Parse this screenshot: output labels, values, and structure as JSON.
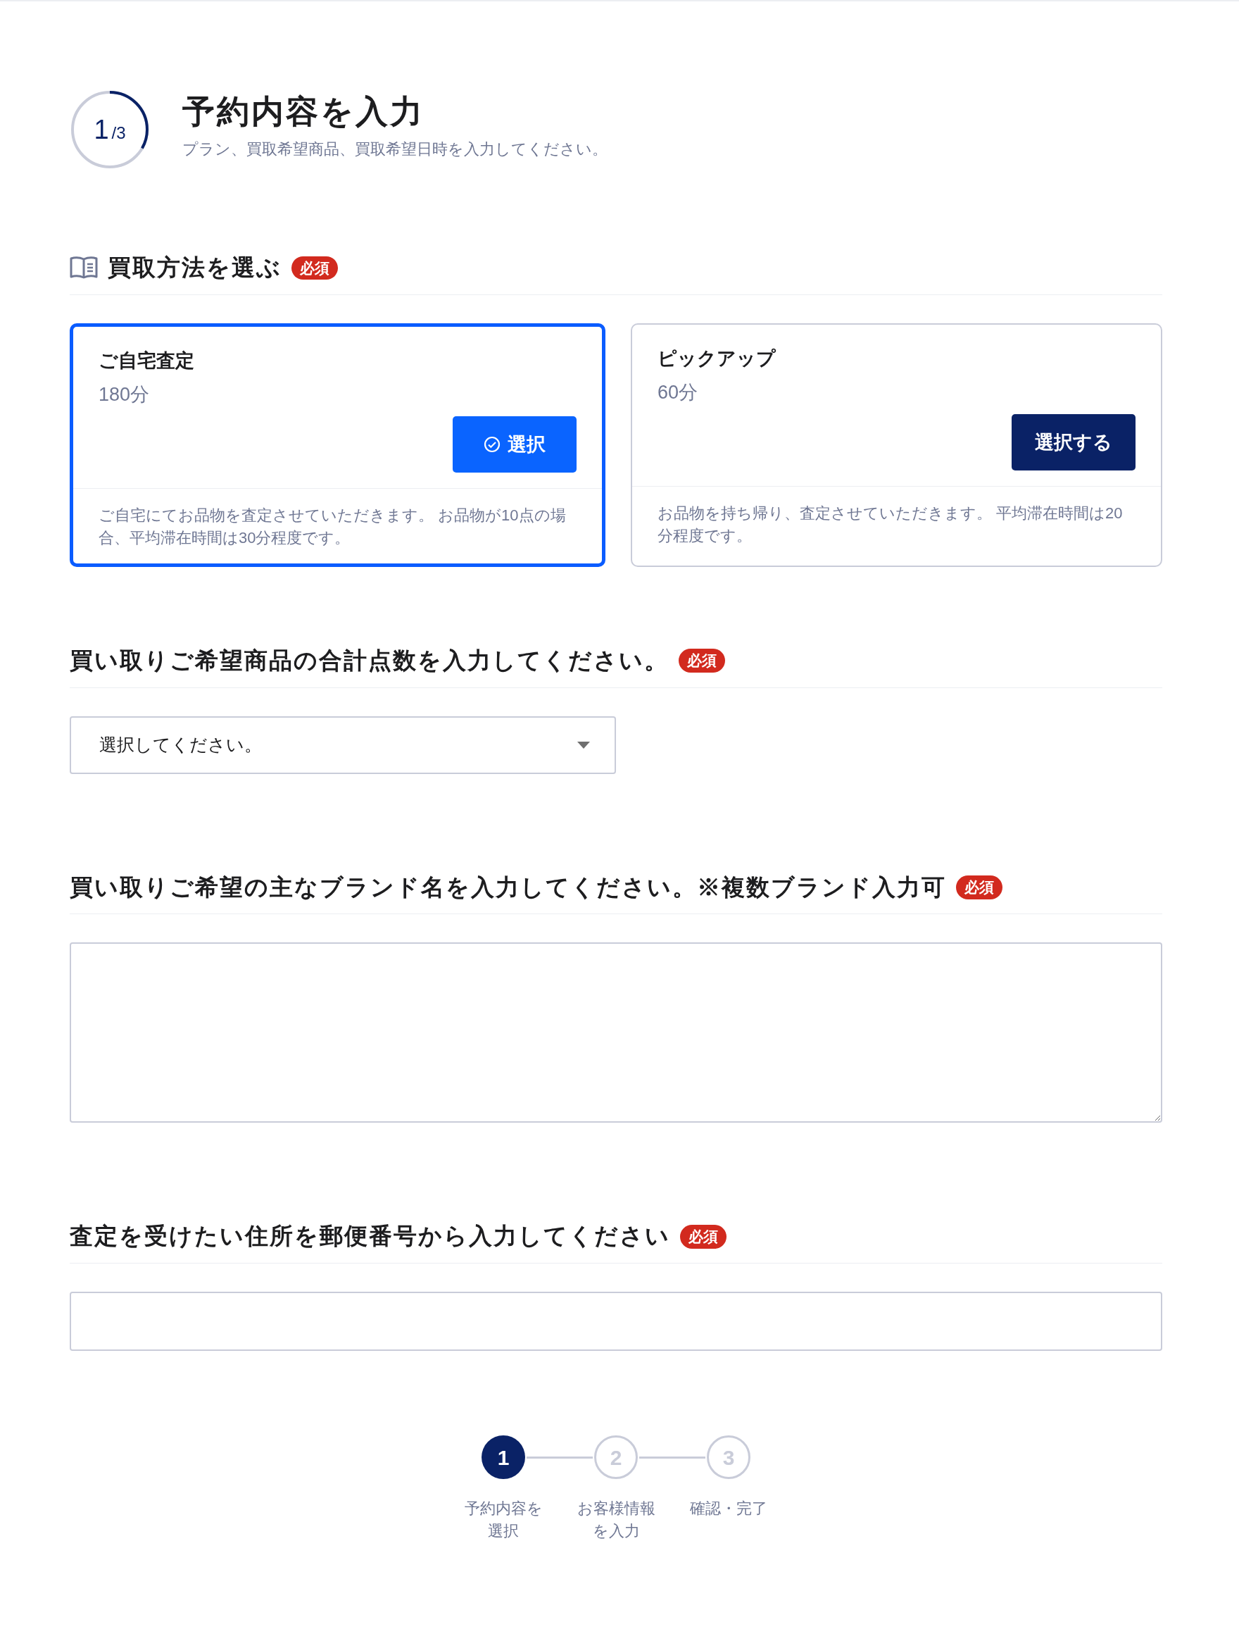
{
  "header": {
    "progress": {
      "current": "1",
      "total": "/3",
      "level": 0.333
    },
    "title": "予約内容を入力",
    "subtitle": "プラン、買取希望商品、買取希望日時を入力してください。"
  },
  "sections": [
    {
      "kind": "plans",
      "title": "買取方法を選ぶ",
      "badge": "必須",
      "plans": [
        {
          "name": "ご自宅査定",
          "duration": "180分",
          "button": "選択",
          "selected": true,
          "description": "ご自宅にてお品物を査定させていただきます。 お品物が10点の場合、平均滞在時間は30分程度です。"
        },
        {
          "name": "ピックアップ",
          "duration": "60分",
          "button": "選択する",
          "selected": false,
          "description": "お品物を持ち帰り、査定させていただきます。 平均滞在時間は20分程度です。"
        }
      ]
    },
    {
      "kind": "select",
      "title": "買い取りご希望商品の合計点数を入力してください。",
      "badge": "必須",
      "value": "選択してください。"
    },
    {
      "kind": "textarea",
      "title": "買い取りご希望の主なブランド名を入力してください。※複数ブランド入力可",
      "badge": "必須"
    },
    {
      "kind": "input",
      "title": "査定を受けたい住所を郵便番号から入力してください",
      "badge": "必須"
    }
  ],
  "steps": [
    {
      "number": "1",
      "label": "予約内容を選択",
      "selected": true
    },
    {
      "number": "2",
      "label": "お客様情報を入力",
      "selected": false
    },
    {
      "number": "3",
      "label": "確認・完了",
      "selected": false
    }
  ]
}
